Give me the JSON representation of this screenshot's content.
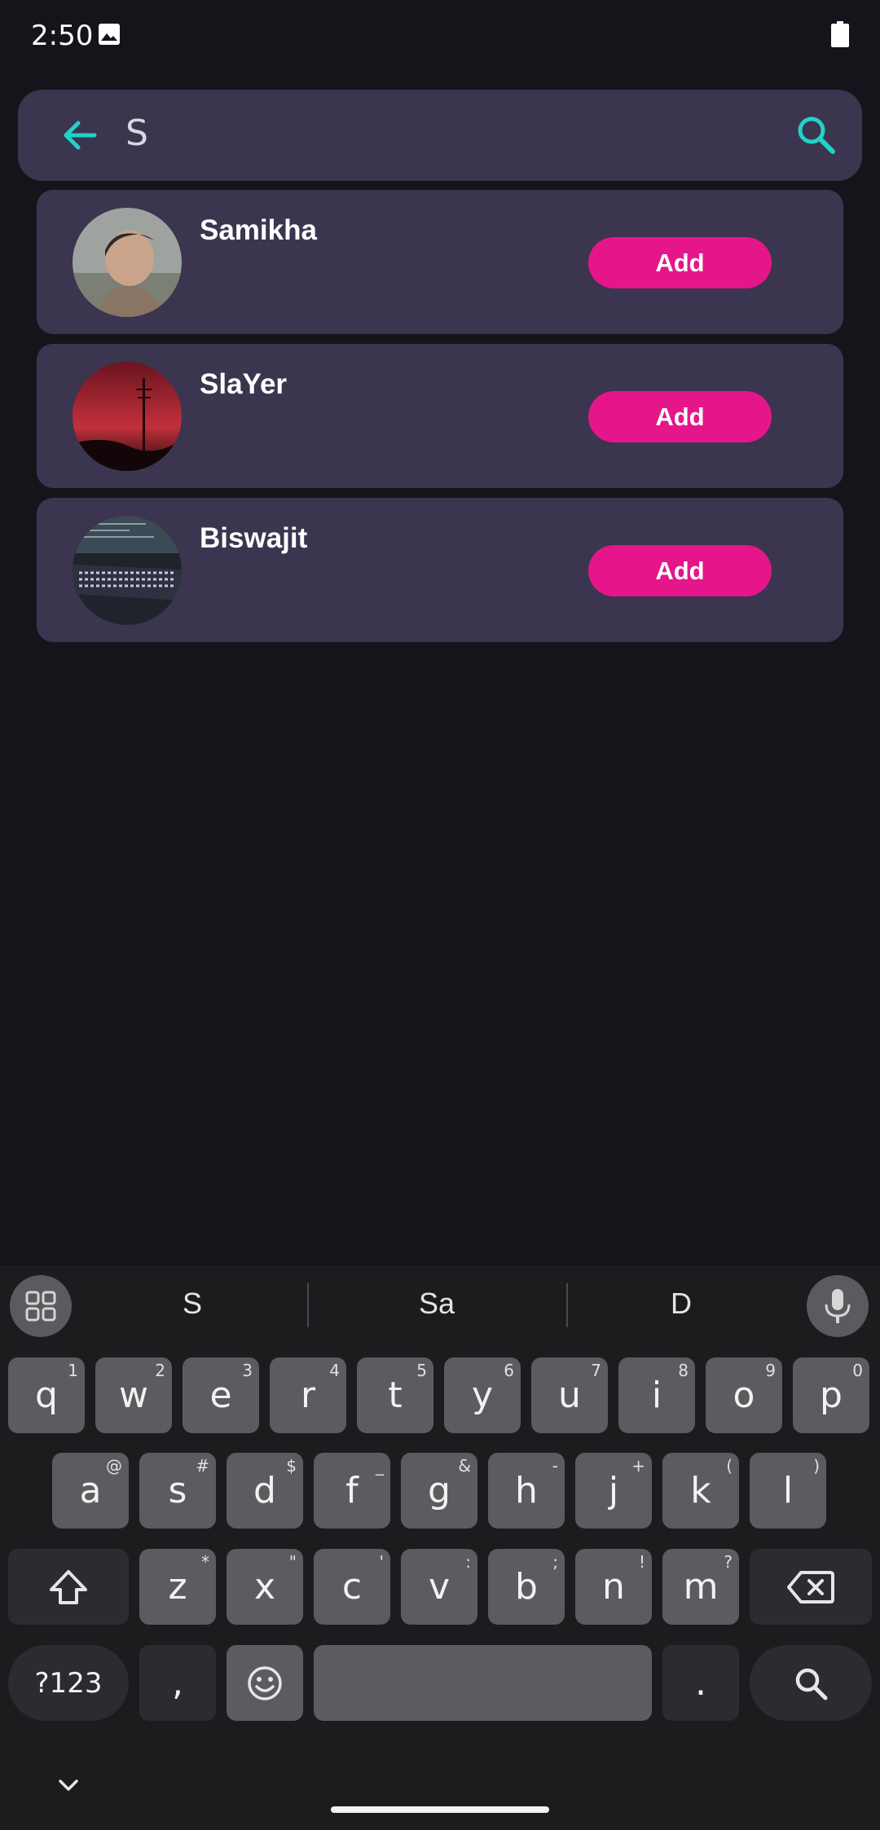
{
  "status_bar": {
    "time": "2:50"
  },
  "search": {
    "query": "S"
  },
  "results": [
    {
      "name": "Samikha",
      "add_label": "Add"
    },
    {
      "name": "SlaYer",
      "add_label": "Add"
    },
    {
      "name": "Biswajit",
      "add_label": "Add"
    }
  ],
  "keyboard": {
    "suggestions": [
      "S",
      "Sa",
      "D"
    ],
    "row1": [
      {
        "k": "q",
        "h": "1"
      },
      {
        "k": "w",
        "h": "2"
      },
      {
        "k": "e",
        "h": "3"
      },
      {
        "k": "r",
        "h": "4"
      },
      {
        "k": "t",
        "h": "5"
      },
      {
        "k": "y",
        "h": "6"
      },
      {
        "k": "u",
        "h": "7"
      },
      {
        "k": "i",
        "h": "8"
      },
      {
        "k": "o",
        "h": "9"
      },
      {
        "k": "p",
        "h": "0"
      }
    ],
    "row2": [
      {
        "k": "a",
        "h": "@"
      },
      {
        "k": "s",
        "h": "#"
      },
      {
        "k": "d",
        "h": "$"
      },
      {
        "k": "f",
        "h": "_"
      },
      {
        "k": "g",
        "h": "&"
      },
      {
        "k": "h",
        "h": "-"
      },
      {
        "k": "j",
        "h": "+"
      },
      {
        "k": "k",
        "h": "("
      },
      {
        "k": "l",
        "h": ")"
      }
    ],
    "row3": [
      {
        "k": "z",
        "h": "*"
      },
      {
        "k": "x",
        "h": "\""
      },
      {
        "k": "c",
        "h": "'"
      },
      {
        "k": "v",
        "h": ":"
      },
      {
        "k": "b",
        "h": ";"
      },
      {
        "k": "n",
        "h": "!"
      },
      {
        "k": "m",
        "h": "?"
      }
    ],
    "symbols_label": "?123",
    "comma_label": ",",
    "period_label": "."
  },
  "colors": {
    "accent": "#22d3c5",
    "add_button": "#e4168a",
    "card": "#3b354f",
    "background": "#16141b"
  }
}
